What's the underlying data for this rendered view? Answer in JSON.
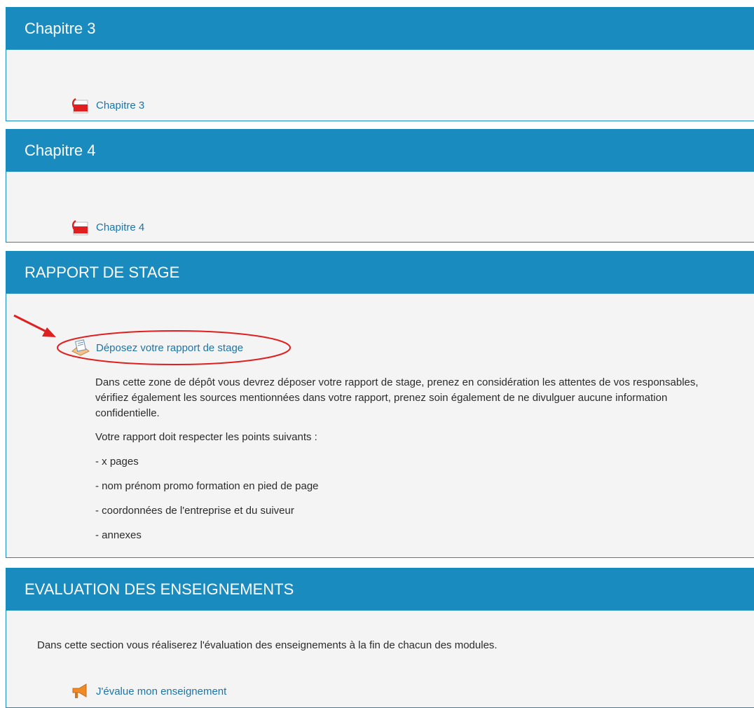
{
  "sections": [
    {
      "title": "Chapitre 3",
      "activity": {
        "label": "Chapitre 3",
        "icon": "pdf-icon"
      }
    },
    {
      "title": "Chapitre 4",
      "activity": {
        "label": "Chapitre 4",
        "icon": "pdf-icon"
      }
    },
    {
      "title": "RAPPORT DE STAGE",
      "activity": {
        "label": "Déposez votre rapport de stage",
        "icon": "assignment-icon"
      },
      "description": {
        "p1": "Dans cette zone de dépôt vous devrez déposer votre rapport de stage, prenez en considération les attentes de vos responsables, vérifiez également les sources mentionnées dans votre rapport, prenez soin également de ne divulguer aucune information confidentielle.",
        "p2": "Votre rapport doit respecter les points suivants :",
        "items": [
          "- x pages",
          "- nom prénom promo formation en pied de page",
          "- coordonnées de l'entreprise et du suiveur",
          "- annexes"
        ]
      }
    },
    {
      "title": "EVALUATION DES ENSEIGNEMENTS",
      "summary": "Dans cette section vous réaliserez l'évaluation des enseignements à la fin de chacun des modules.",
      "activity": {
        "label": "J'évalue mon enseignement",
        "icon": "megaphone-icon"
      }
    }
  ],
  "colors": {
    "header": "#1a8bbf",
    "link": "#1d74a8",
    "annotation": "#e02020"
  }
}
